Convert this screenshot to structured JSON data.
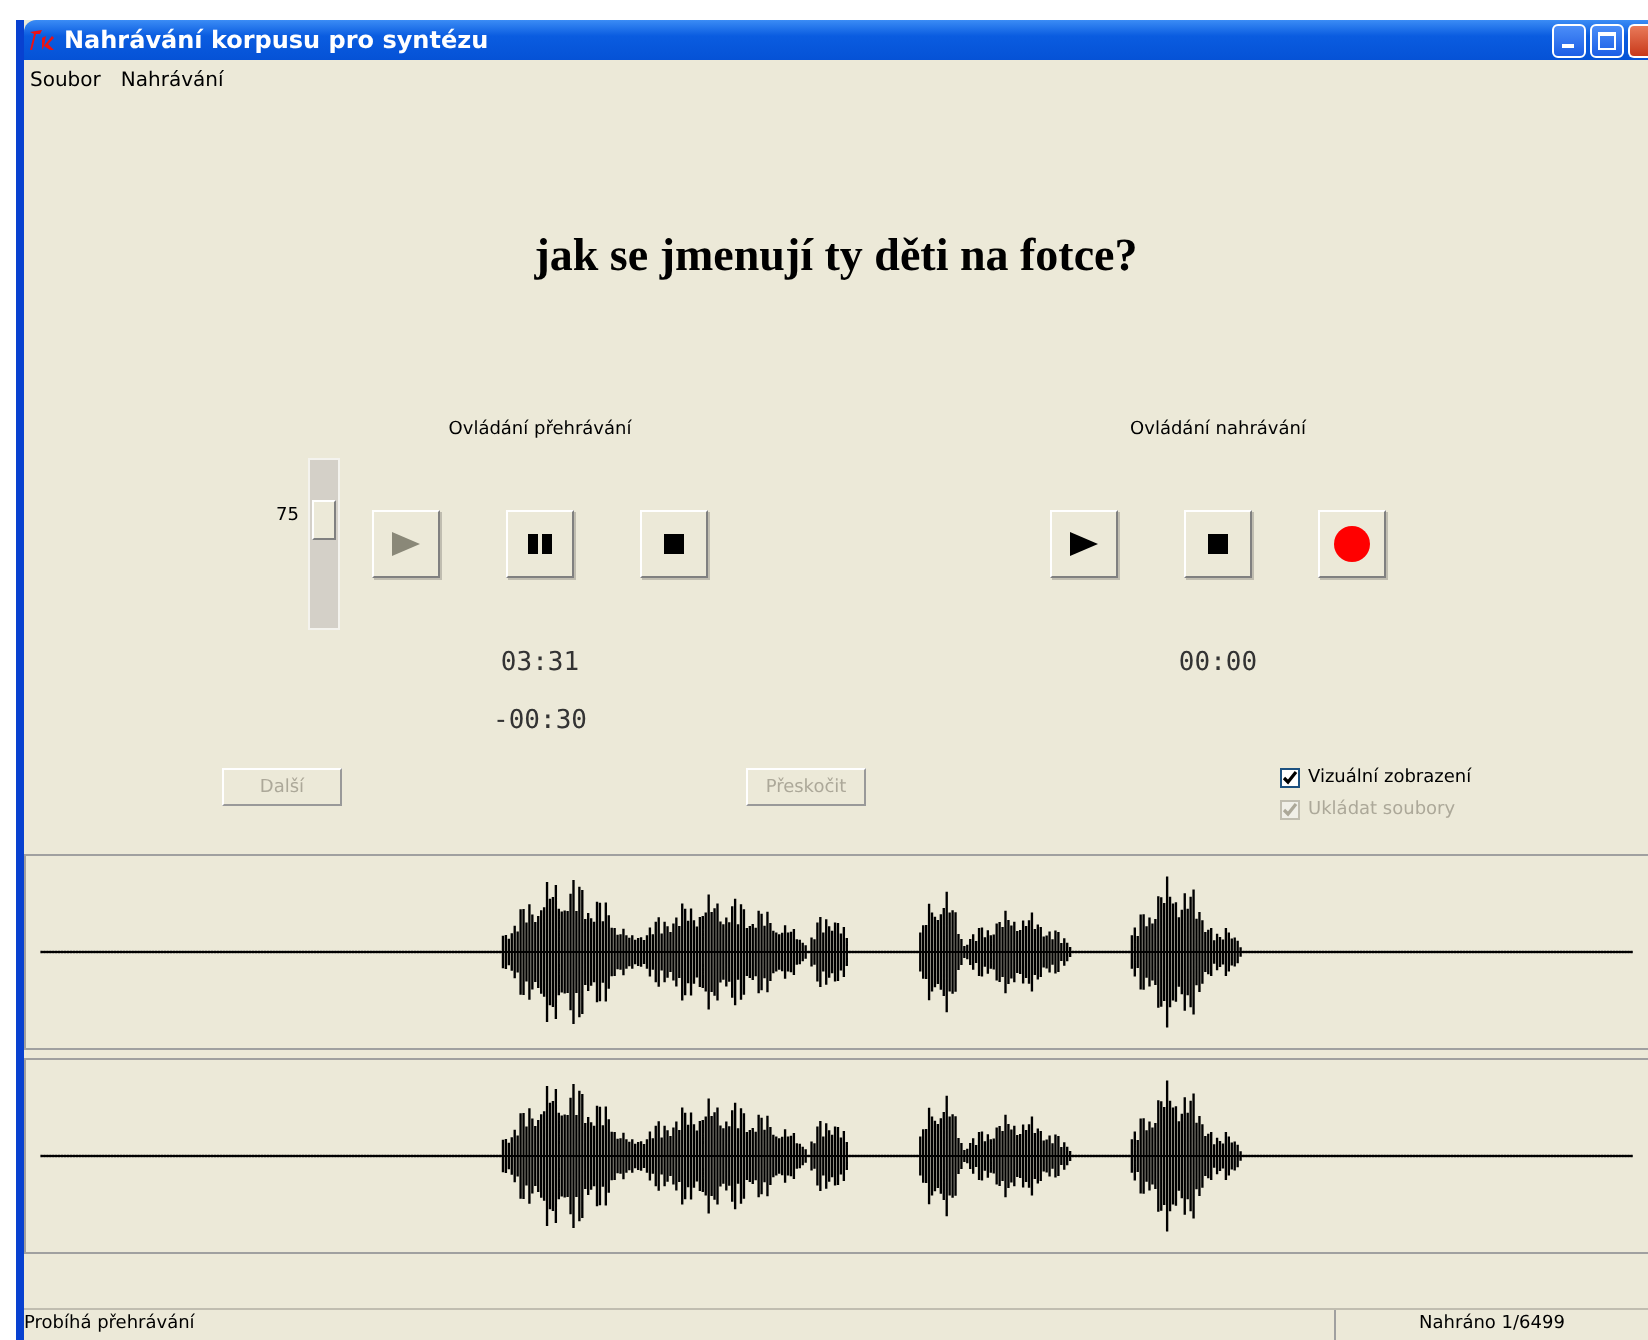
{
  "window": {
    "title": "Nahrávání korpusu pro syntézu"
  },
  "menu": [
    "Soubor",
    "Nahrávání"
  ],
  "prompt": "jak se jmenují ty děti na fotce?",
  "volume": {
    "reading": "75"
  },
  "playback": {
    "label": "Ovládání přehrávání",
    "buttons": [
      {
        "kind": "play",
        "disabled": true
      },
      {
        "kind": "pause",
        "disabled": false
      },
      {
        "kind": "stop",
        "disabled": false
      }
    ],
    "times": [
      "03:31",
      "-00:30"
    ]
  },
  "recording": {
    "label": "Ovládání nahrávání",
    "buttons": [
      {
        "kind": "play",
        "disabled": false
      },
      {
        "kind": "stop",
        "disabled": false
      },
      {
        "kind": "record",
        "disabled": false
      }
    ],
    "times": [
      "00:00"
    ]
  },
  "actions": [
    {
      "label": "Další",
      "disabled": true
    },
    {
      "label": "Přeskočit",
      "disabled": true
    }
  ],
  "options": [
    {
      "label": "Vizuální zobrazení",
      "checked": true,
      "disabled": false
    },
    {
      "label": "Ukládat soubory",
      "checked": true,
      "disabled": true
    }
  ],
  "waveforms": [
    {
      "kind": "picture"
    },
    {
      "kind": "picture"
    }
  ],
  "status_bar": {
    "message": "Probíhá přehrávání",
    "count": "Nahráno 1/6499"
  }
}
